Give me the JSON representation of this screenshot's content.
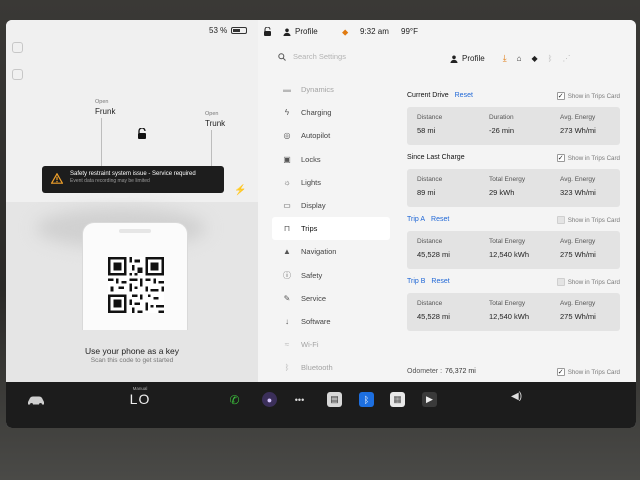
{
  "status": {
    "battery": "53 %",
    "profile": "Profile",
    "time": "9:32 am",
    "temperature": "99°F"
  },
  "car": {
    "frunk_state": "Open",
    "frunk_label": "Frunk",
    "trunk_state": "Open",
    "trunk_label": "Trunk"
  },
  "alert": {
    "title": "Safety restraint system issue - Service required",
    "subtitle": "Event data recording may be limited"
  },
  "phone_key": {
    "title": "Use your phone as a key",
    "subtitle": "Scan this code to get started"
  },
  "search": {
    "placeholder": "Search Settings"
  },
  "header": {
    "profile_label": "Profile"
  },
  "menu": [
    {
      "label": "Dynamics",
      "icon": "car-icon"
    },
    {
      "label": "Charging",
      "icon": "bolt-icon"
    },
    {
      "label": "Autopilot",
      "icon": "steering-wheel-icon"
    },
    {
      "label": "Locks",
      "icon": "lock-icon"
    },
    {
      "label": "Lights",
      "icon": "light-icon"
    },
    {
      "label": "Display",
      "icon": "display-icon"
    },
    {
      "label": "Trips",
      "icon": "trips-icon"
    },
    {
      "label": "Navigation",
      "icon": "navigation-icon"
    },
    {
      "label": "Safety",
      "icon": "safety-icon"
    },
    {
      "label": "Service",
      "icon": "wrench-icon"
    },
    {
      "label": "Software",
      "icon": "download-icon"
    },
    {
      "label": "Wi-Fi",
      "icon": "wifi-icon"
    },
    {
      "label": "Bluetooth",
      "icon": "bluetooth-icon"
    }
  ],
  "trips": {
    "show_label": "Show in Trips Card",
    "reset_label": "Reset",
    "current_drive": {
      "title": "Current Drive",
      "show_checked": true,
      "stats": [
        {
          "label": "Distance",
          "value": "58 mi"
        },
        {
          "label": "Duration",
          "value": "-26 min"
        },
        {
          "label": "Avg. Energy",
          "value": "273 Wh/mi"
        }
      ]
    },
    "since_last_charge": {
      "title": "Since Last Charge",
      "show_checked": true,
      "stats": [
        {
          "label": "Distance",
          "value": "89 mi"
        },
        {
          "label": "Total Energy",
          "value": "29 kWh"
        },
        {
          "label": "Avg. Energy",
          "value": "323 Wh/mi"
        }
      ]
    },
    "trip_a": {
      "title": "Trip A",
      "show_checked": false,
      "stats": [
        {
          "label": "Distance",
          "value": "45,528 mi"
        },
        {
          "label": "Total Energy",
          "value": "12,540 kWh"
        },
        {
          "label": "Avg. Energy",
          "value": "275 Wh/mi"
        }
      ]
    },
    "trip_b": {
      "title": "Trip B",
      "show_checked": false,
      "stats": [
        {
          "label": "Distance",
          "value": "45,528 mi"
        },
        {
          "label": "Total Energy",
          "value": "12,540 kWh"
        },
        {
          "label": "Avg. Energy",
          "value": "275 Wh/mi"
        }
      ]
    },
    "odometer": {
      "label": "Odometer :",
      "value": "76,372 mi",
      "show_checked": true
    }
  },
  "bottom_bar": {
    "climate_label": "Manual",
    "climate_value": "LO"
  },
  "colors": {
    "accent": "#1e66d6",
    "warning": "#e07a10",
    "dock": "#1c1c1c"
  }
}
